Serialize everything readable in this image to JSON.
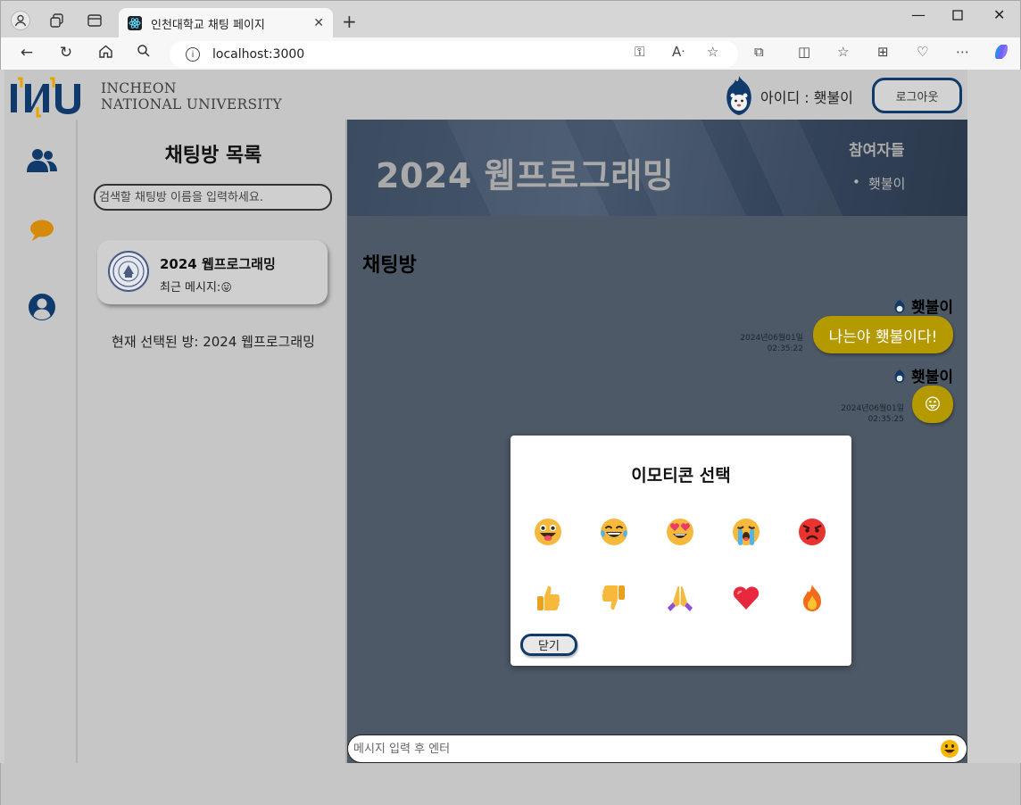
{
  "browser": {
    "tab_title": "인천대학교 채팅 페이지",
    "url": "localhost:3000"
  },
  "header": {
    "logo_line1": "INCHEON",
    "logo_line2": "NATIONAL UNIVERSITY",
    "user_id_label": "아이디 : 횃불이",
    "logout_label": "로그아웃"
  },
  "sidebar": {
    "items": [
      {
        "icon": "users-icon"
      },
      {
        "icon": "chat-bubble-icon"
      },
      {
        "icon": "user-profile-icon"
      }
    ]
  },
  "room_list": {
    "title": "채팅방 목록",
    "search_placeholder": "검색할 채팅방 이름을 입력하세요.",
    "rooms": [
      {
        "name": "2024 웹프로그래밍",
        "last_message_label": "최근 메시지:",
        "last_message_emoji": "😛"
      }
    ],
    "selected_label": "현재 선택된 방: 2024 웹프로그래밍"
  },
  "chat": {
    "banner_title": "2024 웹프로그래밍",
    "participants_title": "참여자들",
    "participants": [
      "횃불이"
    ],
    "heading": "채팅방",
    "messages": [
      {
        "sender": "횃불이",
        "text": "나는야 횃불이다!",
        "date": "2024년06월01일",
        "time": "02:35:22"
      },
      {
        "sender": "횃불이",
        "text": "😛",
        "date": "2024년06월01일",
        "time": "02:35:25"
      }
    ],
    "input_placeholder": "메시지 입력 후 엔터"
  },
  "emoji_modal": {
    "title": "이모티콘 선택",
    "emojis": [
      "😛",
      "😂",
      "😍",
      "😭",
      "😡",
      "👍",
      "👎",
      "🙏",
      "❤️",
      "🔥"
    ],
    "close_label": "닫기"
  },
  "colors": {
    "brand_navy": "#0f3a6b",
    "bubble": "#b49a00",
    "chat_bg": "#4d5966",
    "page_bg": "#c6c6c6"
  }
}
